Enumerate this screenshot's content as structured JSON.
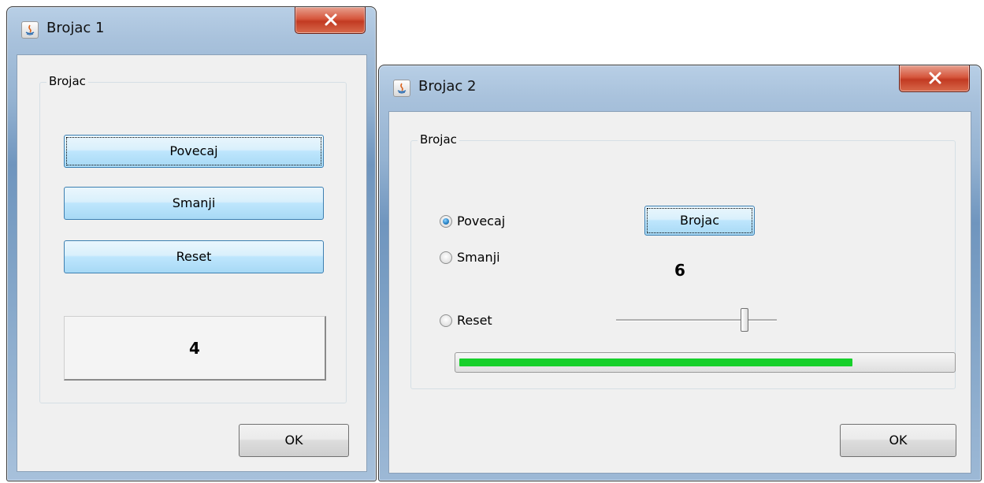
{
  "window1": {
    "title": "Brojac 1",
    "group_title": "Brojac",
    "buttons": {
      "povecaj": "Povecaj",
      "smanji": "Smanji",
      "reset": "Reset"
    },
    "counter_value": "4",
    "ok_label": "OK"
  },
  "window2": {
    "title": "Brojac 2",
    "group_title": "Brojac",
    "radios": [
      {
        "label": "Povecaj",
        "checked": true
      },
      {
        "label": "Smanji",
        "checked": false
      },
      {
        "label": "Reset",
        "checked": false
      }
    ],
    "brojac_button": "Brojac",
    "counter_value": "6",
    "slider_level": 0.8,
    "progress_level": 0.8,
    "progress_color": "#16d02a",
    "ok_label": "OK"
  },
  "icons": {
    "app": "java-icon",
    "close": "close-icon"
  }
}
